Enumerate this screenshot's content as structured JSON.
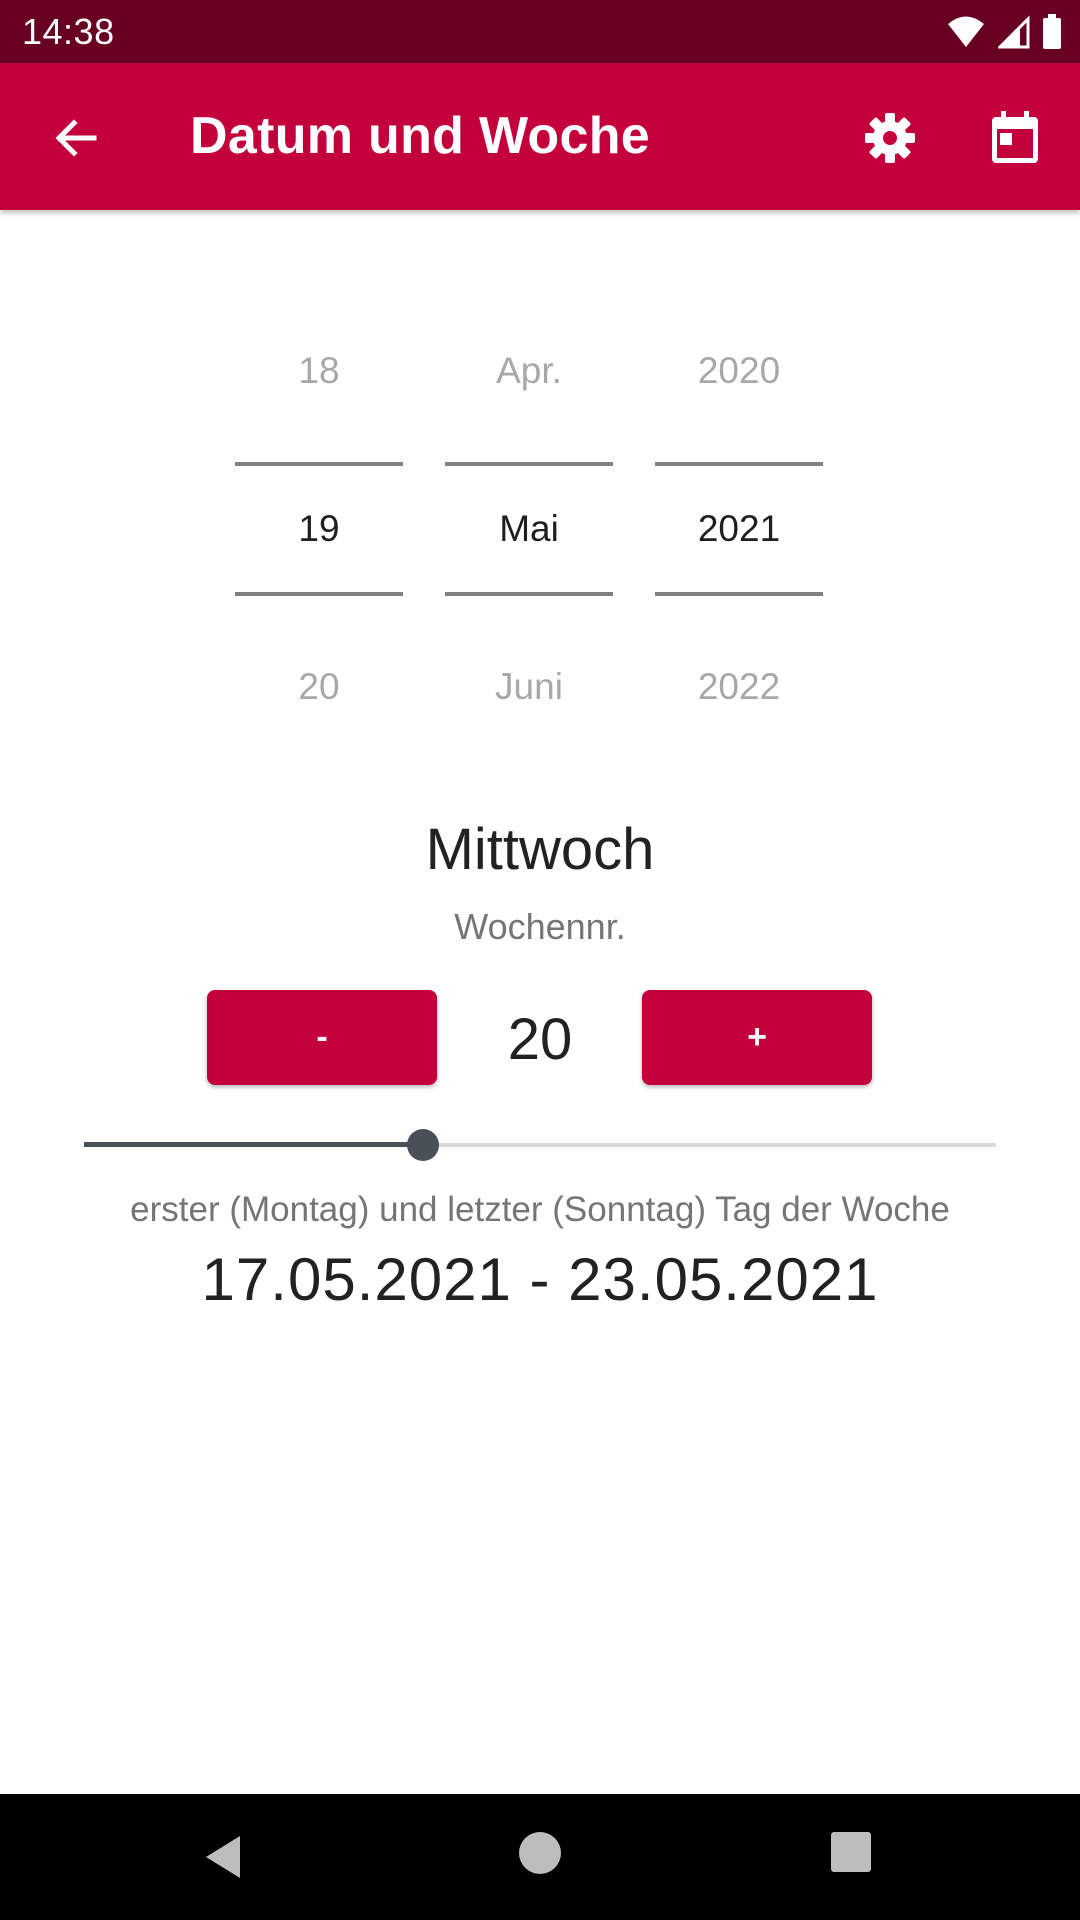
{
  "status_bar": {
    "time": "14:38"
  },
  "app_bar": {
    "title": "Datum und Woche",
    "back_icon": "arrow-back-icon",
    "settings_icon": "gear-icon",
    "calendar_icon": "calendar-icon"
  },
  "date_picker": {
    "day": {
      "prev": "18",
      "current": "19",
      "next": "20"
    },
    "month": {
      "prev": "Apr.",
      "current": "Mai",
      "next": "Juni"
    },
    "year": {
      "prev": "2020",
      "current": "2021",
      "next": "2022"
    }
  },
  "weekday": "Mittwoch",
  "week": {
    "label": "Wochennr.",
    "minus_label": "-",
    "plus_label": "+",
    "number": "20",
    "slider_fraction": 0.372
  },
  "range": {
    "label": "erster (Montag) und letzter (Sonntag) Tag der Woche",
    "value": "17.05.2021 - 23.05.2021"
  },
  "colors": {
    "status_bar": "#670022",
    "primary": "#c4003c",
    "slider": "#4a5058"
  }
}
